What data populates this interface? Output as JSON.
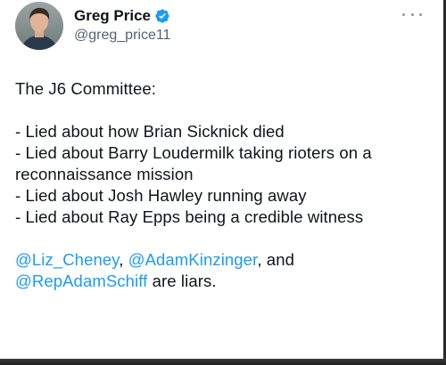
{
  "author": {
    "display_name": "Greg Price",
    "handle": "@greg_price11",
    "verified": true
  },
  "tweet": {
    "intro": "The J6 Committee:",
    "items": [
      "- Lied about how Brian Sicknick died",
      "- Lied about Barry Loudermilk taking rioters on a reconnaissance mission",
      "- Lied about Josh Hawley running away",
      "- Lied about Ray Epps being a credible witness"
    ],
    "closing": {
      "mention_1": "@Liz_Cheney",
      "sep_1": ", ",
      "mention_2": "@AdamKinzinger",
      "sep_2": ", and ",
      "mention_3": "@RepAdamSchiff",
      "tail": " are liars."
    }
  },
  "icons": {
    "verified": "verified-badge-icon",
    "more": "more-options-icon",
    "avatar": "avatar"
  },
  "colors": {
    "text": "#0f1419",
    "secondary": "#536471",
    "mention": "#1d9bf0",
    "verified": "#1d9bf0"
  }
}
